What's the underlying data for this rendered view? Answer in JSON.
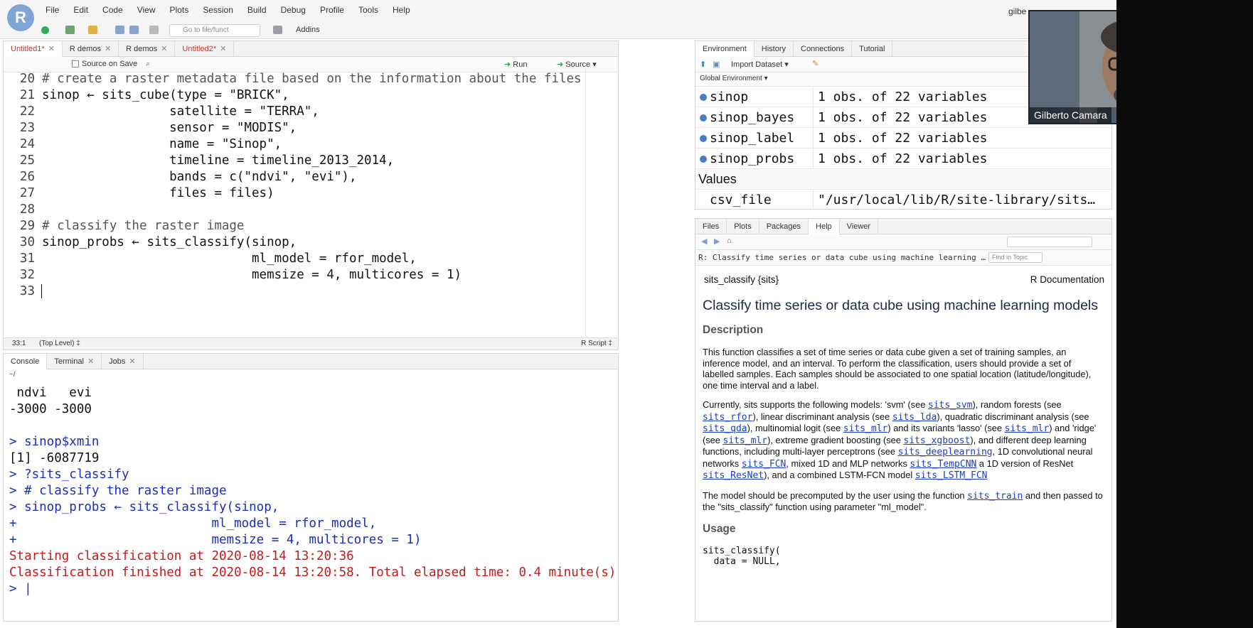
{
  "menubar": {
    "logo": "R",
    "items": [
      "File",
      "Edit",
      "Code",
      "View",
      "Plots",
      "Session",
      "Build",
      "Debug",
      "Profile",
      "Tools",
      "Help"
    ],
    "user": "gilbe"
  },
  "toolbar": {
    "goto_placeholder": "Go to file/funct",
    "addins_label": "Addins"
  },
  "editor": {
    "tabs": [
      {
        "label": "Untitled1*",
        "active": true
      },
      {
        "label": "R demos",
        "active": false
      },
      {
        "label": "R demos",
        "active": false
      },
      {
        "label": "Untitled2*",
        "active": false
      }
    ],
    "source_on_save": "Source on Save",
    "run_label": "Run",
    "source_label": "Source",
    "lines": [
      {
        "n": "20",
        "text": "# create a raster metadata file based on the information about the files"
      },
      {
        "n": "21",
        "text": "sinop ← sits_cube(type = \"BRICK\","
      },
      {
        "n": "22",
        "text": "                 satellite = \"TERRA\","
      },
      {
        "n": "23",
        "text": "                 sensor = \"MODIS\","
      },
      {
        "n": "24",
        "text": "                 name = \"Sinop\","
      },
      {
        "n": "25",
        "text": "                 timeline = timeline_2013_2014,"
      },
      {
        "n": "26",
        "text": "                 bands = c(\"ndvi\", \"evi\"),"
      },
      {
        "n": "27",
        "text": "                 files = files)"
      },
      {
        "n": "28",
        "text": ""
      },
      {
        "n": "29",
        "text": "# classify the raster image"
      },
      {
        "n": "30",
        "text": "sinop_probs ← sits_classify(sinop,"
      },
      {
        "n": "31",
        "text": "                            ml_model = rfor_model,"
      },
      {
        "n": "32",
        "text": "                            memsize = 4, multicores = 1)"
      },
      {
        "n": "33",
        "text": ""
      }
    ],
    "status_position": "33:1",
    "status_scope": "(Top Level) ‡",
    "status_type": "R Script ‡"
  },
  "console": {
    "tabs": [
      "Console",
      "Terminal",
      "Jobs"
    ],
    "path": "~/",
    "lines": [
      {
        "kind": "out",
        "text": " ndvi   evi"
      },
      {
        "kind": "out",
        "text": "-3000 -3000"
      },
      {
        "kind": "out",
        "text": ""
      },
      {
        "kind": "in",
        "text": "> sinop$xmin"
      },
      {
        "kind": "out",
        "text": "[1] -6087719"
      },
      {
        "kind": "in",
        "text": "> ?sits_classify"
      },
      {
        "kind": "in",
        "text": "> # classify the raster image"
      },
      {
        "kind": "in",
        "text": "> sinop_probs ← sits_classify(sinop,"
      },
      {
        "kind": "in",
        "text": "+                          ml_model = rfor_model,"
      },
      {
        "kind": "in",
        "text": "+                          memsize = 4, multicores = 1)"
      },
      {
        "kind": "err",
        "text": "Starting classification at 2020-08-14 13:20:36"
      },
      {
        "kind": "err",
        "text": "Classification finished at 2020-08-14 13:20:58. Total elapsed time: 0.4 minute(s)."
      },
      {
        "kind": "in",
        "text": "> |"
      }
    ]
  },
  "environment": {
    "tabs": [
      "Environment",
      "History",
      "Connections",
      "Tutorial"
    ],
    "import_label": "Import Dataset",
    "scope": "Global Environment",
    "rows": [
      {
        "name": "sinop",
        "value": "1 obs. of 22 variables"
      },
      {
        "name": "sinop_bayes",
        "value": "1 obs. of 22 variables"
      },
      {
        "name": "sinop_label",
        "value": "1 obs. of 22 variables"
      },
      {
        "name": "sinop_probs",
        "value": "1 obs. of 22 variables"
      }
    ],
    "values_header": "Values",
    "value_rows": [
      {
        "name": "csv_file",
        "value": "\"/usr/local/lib/R/site-library/sits…"
      }
    ]
  },
  "help": {
    "tabs": [
      "Files",
      "Plots",
      "Packages",
      "Help",
      "Viewer"
    ],
    "topic": "R: Classify time series or data cube using machine learning …",
    "find_placeholder": "Find in Topic",
    "pkg": "sits_classify {sits}",
    "rdoc": "R Documentation",
    "title": "Classify time series or data cube using machine learning models",
    "desc_header": "Description",
    "desc1": "This function classifies a set of time series or data cube given a set of training samples, an inference model, and an interval. To perform the classification, users should provide a set of labelled samples. Each samples should be associated to one spatial location (latitude/longitude), one time interval and a label.",
    "p2": {
      "t1": "Currently, sits supports the following models: 'svm' (see ",
      "l1": "sits_svm",
      "t2": "), random forests (see ",
      "l2": "sits_rfor",
      "t3": "), linear discriminant analysis (see ",
      "l3": "sits_lda",
      "t4": "), quadratic discriminant analysis (see ",
      "l4": "sits_qda",
      "t5": "), multinomial logit (see ",
      "l5": "sits_mlr",
      "t6": ") and its variants 'lasso' (see ",
      "l6": "sits_mlr",
      "t7": ") and 'ridge' (see ",
      "l7": "sits_mlr",
      "t8": "), extreme gradient boosting (see ",
      "l8": "sits_xgboost",
      "t9": "), and different deep learning functions, including multi-layer perceptrons (see ",
      "l9": "sits_deeplearning",
      "t10": ", 1D convolutional neural networks ",
      "l10": "sits_FCN",
      "t11": ", mixed 1D and MLP networks ",
      "l11": "sits_TempCNN",
      "t12": " a 1D version of ResNet ",
      "l12": "sits_ResNet",
      "t13": "), and a combined LSTM-FCN model ",
      "l13": "sits_LSTM_FCN"
    },
    "p3a": "The model should be precomputed by the user using the function ",
    "p3link": "sits_train",
    "p3b": " and then passed to the \"sits_classify\" function using parameter \"ml_model\".",
    "usage_header": "Usage",
    "usage1": "sits_classify(",
    "usage2": "  data = NULL,"
  },
  "webcam": {
    "name": "Gilberto Camara"
  }
}
